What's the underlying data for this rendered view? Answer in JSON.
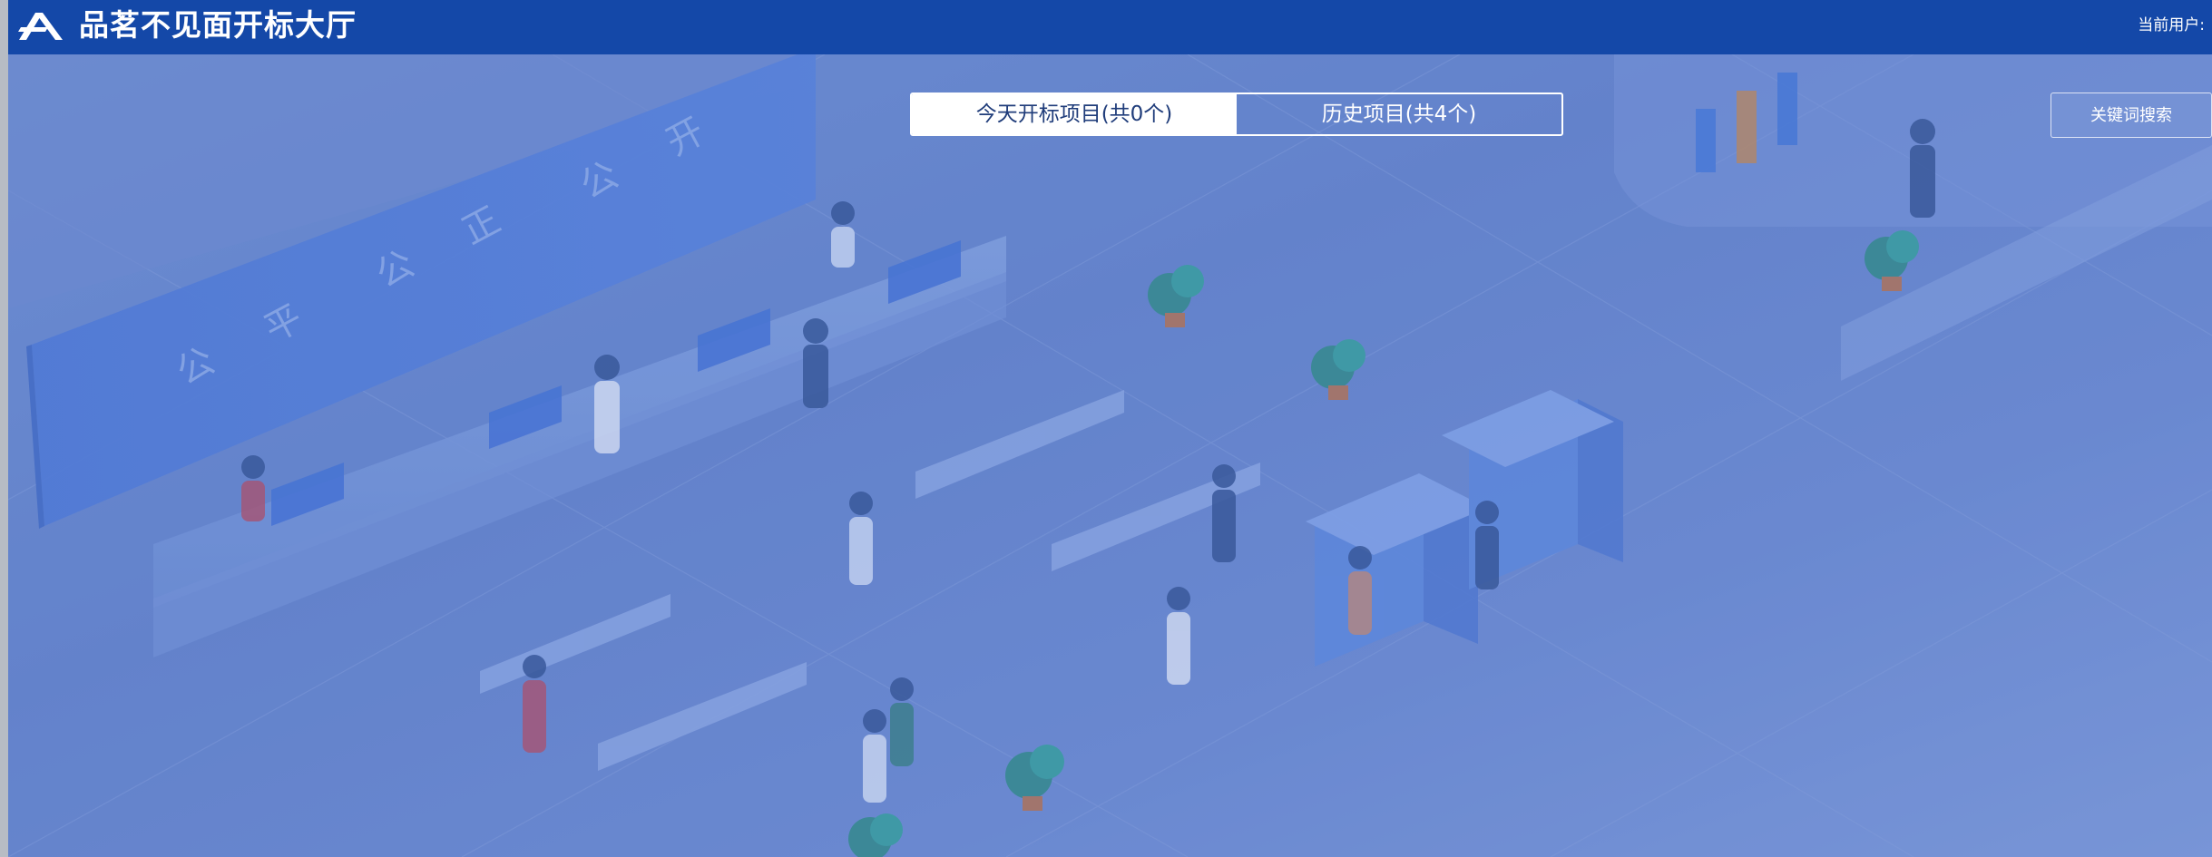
{
  "header": {
    "title": "品茗不见面开标大厅",
    "current_user_label": "当前用户:",
    "logo_icon": "pinming-logo-icon",
    "bar_color": "#1448a8"
  },
  "tabs": [
    {
      "label": "今天开标项目(共0个)",
      "active": true
    },
    {
      "label": "历史项目(共4个)",
      "active": false
    }
  ],
  "search": {
    "button_label": "关键词搜索",
    "icon": "search"
  },
  "background": {
    "description_icon": "hall-illustration",
    "wall_text": [
      "公",
      "平",
      "公",
      "正",
      "公",
      "开"
    ],
    "overlay_color": "#6582cc"
  }
}
